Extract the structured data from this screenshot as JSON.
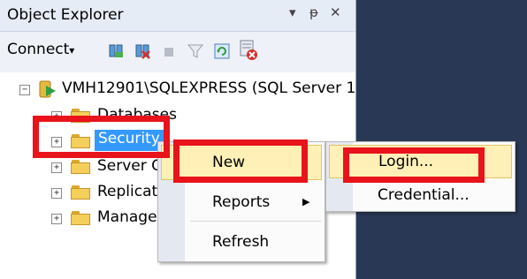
{
  "panel": {
    "title": "Object Explorer",
    "pin_glyph": "▾",
    "pushpin_glyph": "ᵽ",
    "close_glyph": "✕"
  },
  "toolbar": {
    "connect_label": "Connect",
    "connect_arrow": "▾",
    "icons": [
      "connect-object-explorer-icon",
      "disconnect-icon",
      "stop-icon",
      "filter-icon",
      "refresh-icon",
      "activity-monitor-icon"
    ]
  },
  "tree": {
    "server_label": "VMH12901\\SQLEXPRESS (SQL Server 11",
    "server_expander": "−",
    "nodes": [
      {
        "label": "Databases",
        "expander": "+"
      },
      {
        "label": "Security",
        "expander": "+"
      },
      {
        "label": "Server O",
        "expander": "+"
      },
      {
        "label": "Replicat",
        "expander": "+"
      },
      {
        "label": "Manage",
        "expander": "+"
      }
    ]
  },
  "context_menu": {
    "new_label": "New",
    "reports_label": "Reports",
    "reports_arrow": "▶",
    "refresh_label": "Refresh"
  },
  "new_submenu": {
    "login_label": "Login...",
    "credential_label": "Credential..."
  },
  "colors": {
    "highlight_red": "#e8131b",
    "selection_blue": "#3399ff",
    "menu_hover": "#fff0b7",
    "dark_background": "#293955"
  }
}
